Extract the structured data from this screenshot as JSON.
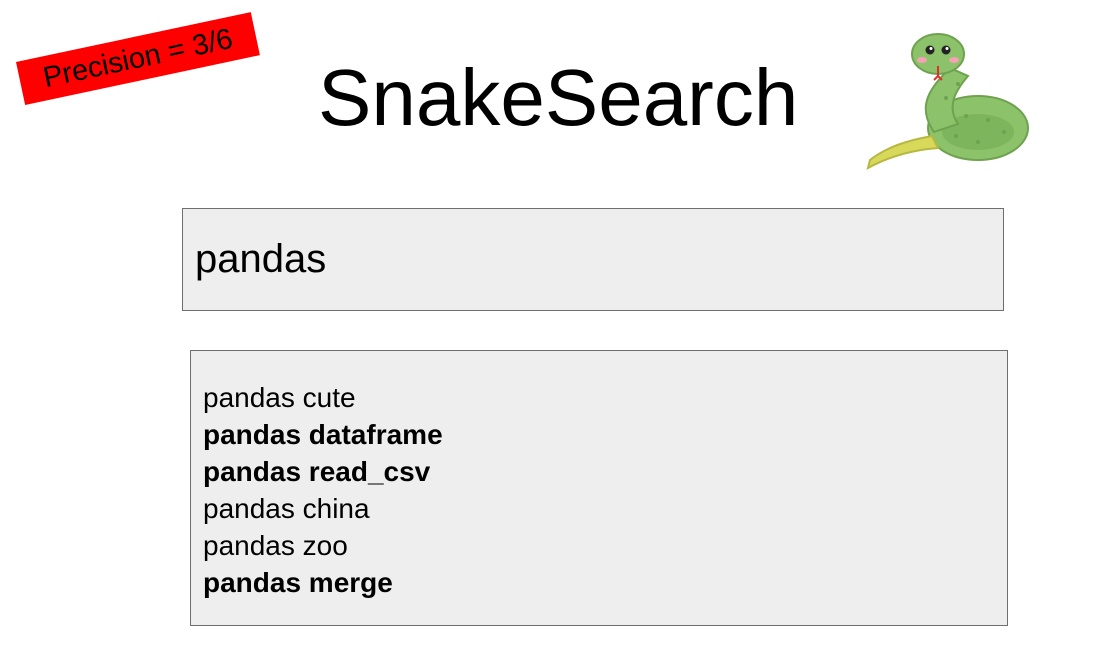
{
  "badge": {
    "text": "Precision = 3/6",
    "color": "#ff0000"
  },
  "header": {
    "title": "SnakeSearch",
    "logo_icon": "snake-icon"
  },
  "search": {
    "query": "pandas"
  },
  "results": [
    {
      "text": "pandas cute",
      "relevant": false
    },
    {
      "text": "pandas dataframe",
      "relevant": true
    },
    {
      "text": "pandas read_csv",
      "relevant": true
    },
    {
      "text": "pandas china",
      "relevant": false
    },
    {
      "text": "pandas zoo",
      "relevant": false
    },
    {
      "text": "pandas merge",
      "relevant": true
    }
  ]
}
